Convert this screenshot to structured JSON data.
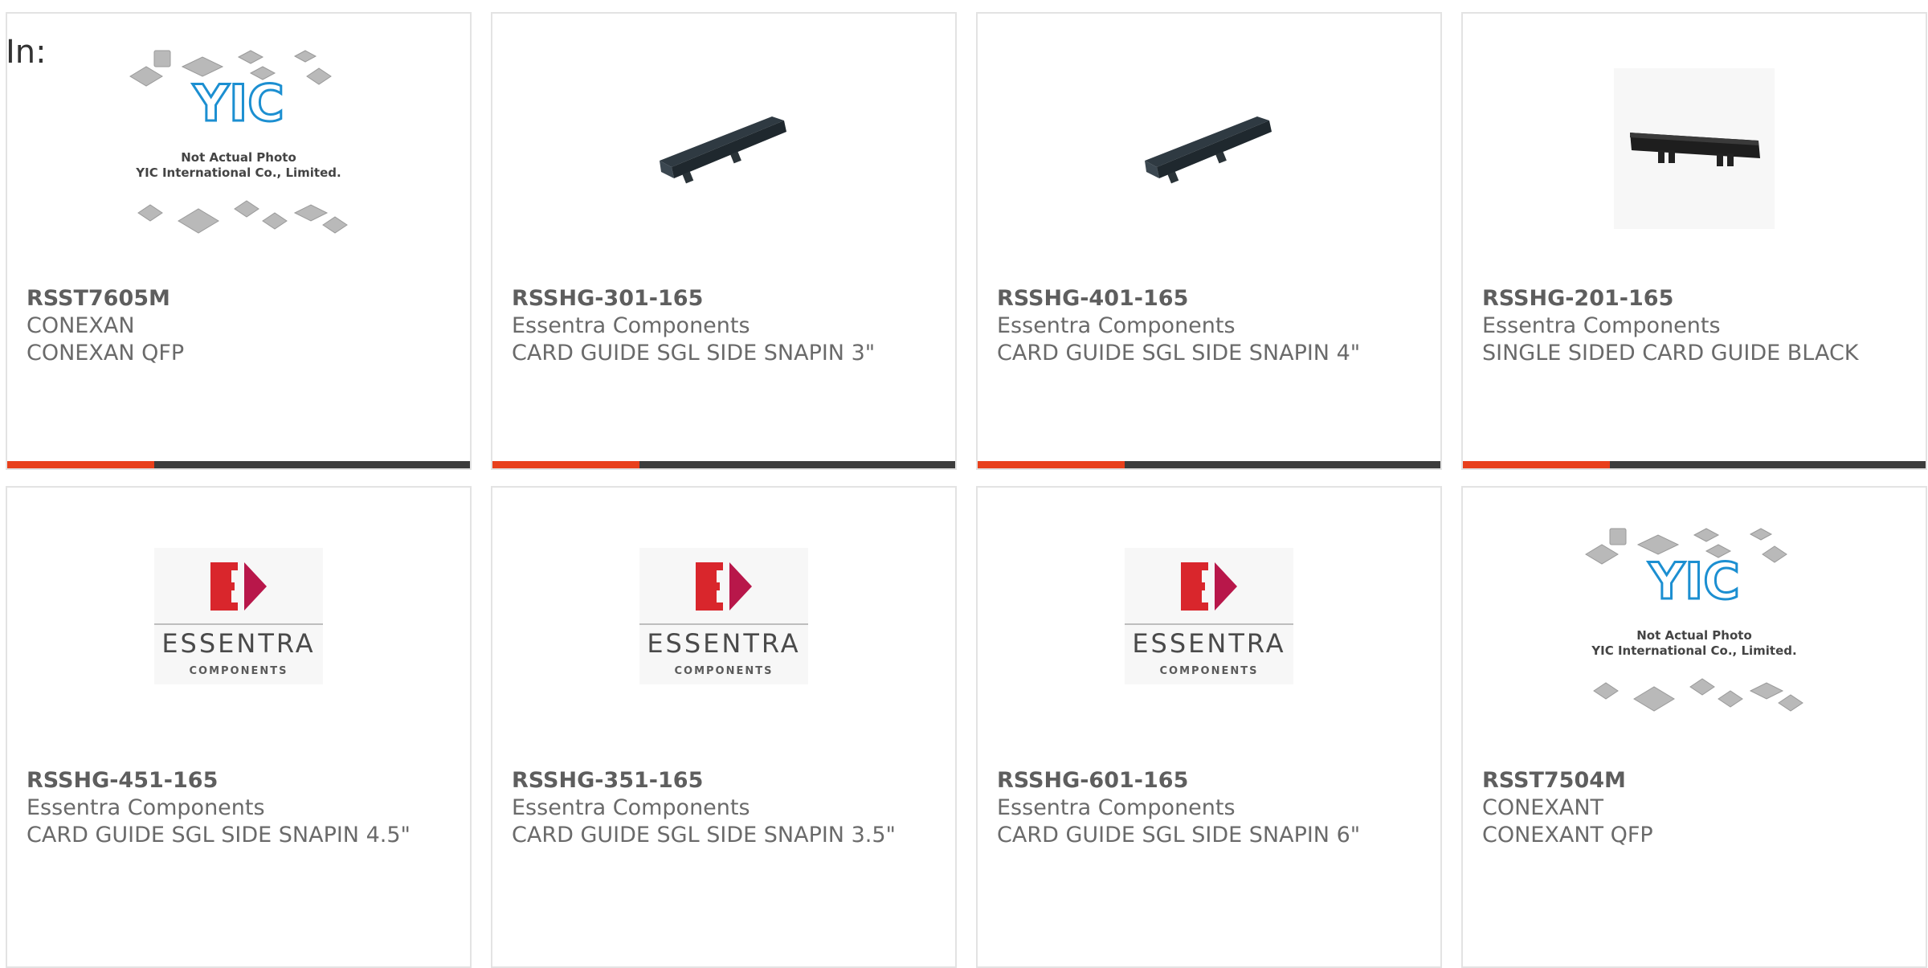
{
  "filter_label": "In:",
  "products": [
    {
      "part_no": "RSST7605M",
      "maker": "CONEXAN",
      "desc": "CONEXAN QFP",
      "image": "yic-placeholder",
      "placeholder_line1": "Not Actual Photo",
      "placeholder_line2": "YIC International Co., Limited.",
      "logo_text": "YIC"
    },
    {
      "part_no": "RSSHG-301-165",
      "maker": "Essentra Components",
      "desc": "CARD GUIDE SGL SIDE SNAPIN 3\"",
      "image": "card-guide"
    },
    {
      "part_no": "RSSHG-401-165",
      "maker": "Essentra Components",
      "desc": "CARD GUIDE SGL SIDE SNAPIN 4\"",
      "image": "card-guide"
    },
    {
      "part_no": "RSSHG-201-165",
      "maker": "Essentra Components",
      "desc": "SINGLE SIDED CARD GUIDE BLACK",
      "image": "card-guide-black"
    },
    {
      "part_no": "RSSHG-451-165",
      "maker": "Essentra Components",
      "desc": "CARD GUIDE SGL SIDE SNAPIN 4.5\"",
      "image": "essentra-logo",
      "logo_word": "ESSENTRA",
      "logo_sub": "COMPONENTS"
    },
    {
      "part_no": "RSSHG-351-165",
      "maker": "Essentra Components",
      "desc": "CARD GUIDE SGL SIDE SNAPIN 3.5\"",
      "image": "essentra-logo",
      "logo_word": "ESSENTRA",
      "logo_sub": "COMPONENTS"
    },
    {
      "part_no": "RSSHG-601-165",
      "maker": "Essentra Components",
      "desc": "CARD GUIDE SGL SIDE SNAPIN 6\"",
      "image": "essentra-logo",
      "logo_word": "ESSENTRA",
      "logo_sub": "COMPONENTS"
    },
    {
      "part_no": "RSST7504M",
      "maker": "CONEXANT",
      "desc": "CONEXANT QFP",
      "image": "yic-placeholder",
      "placeholder_line1": "Not Actual Photo",
      "placeholder_line2": "YIC International Co., Limited.",
      "logo_text": "YIC"
    }
  ],
  "colors": {
    "accent_orange": "#e8401c",
    "accent_dark": "#3c3c3c",
    "border": "#e3e3e3",
    "text": "#6a6a6a",
    "essentra_red": "#d9262c",
    "yic_blue": "#1c8fd1"
  }
}
